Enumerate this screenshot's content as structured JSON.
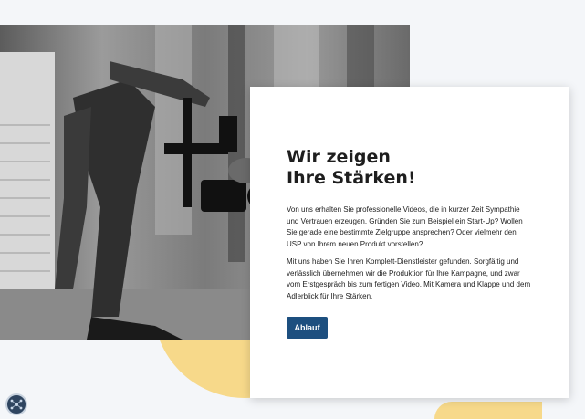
{
  "hero": {
    "heading_line1": "Wir zeigen",
    "heading_line2": "Ihre Stärken!",
    "paragraph1": "Von uns erhalten Sie professionelle Videos, die in kurzer Zeit Sympathie und Vertrauen erzeugen. Gründen Sie zum Beispiel ein Start-Up? Wollen Sie gerade eine bestimmte Zielgruppe ansprechen? Oder vielmehr den USP von Ihrem neuen Produkt vorstellen?",
    "paragraph2": "Mit uns haben Sie Ihren Komplett-Dienstleister gefunden. Sorgfältig und verlässlich übernehmen wir die Produktion für Ihre Kampagne, und zwar vom Erstgespräch bis zum fertigen Video. Mit Kamera und Klappe und dem Adlerblick für Ihre Stärken.",
    "cta_label": "Ablauf"
  },
  "colors": {
    "accent_yellow": "#f7d98a",
    "button_blue": "#1d4f7f",
    "background": "#f4f6f9"
  },
  "icons": {
    "widget": "network-icon"
  }
}
